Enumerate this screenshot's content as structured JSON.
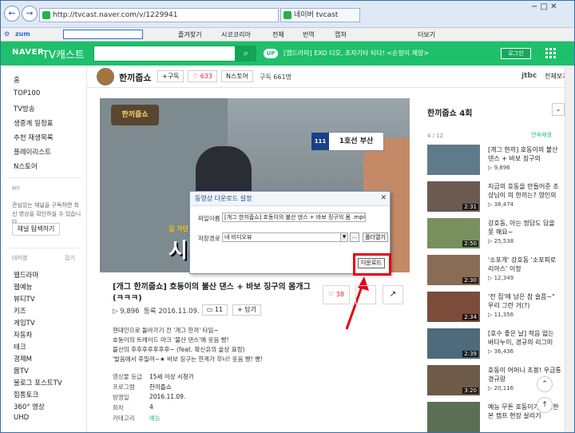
{
  "browser": {
    "back": "←",
    "forward": "→",
    "address": "http://tvcast.naver.com/v/1229941",
    "tab_label": "네이버 tvcast",
    "win_controls": "− □ ✕",
    "toolbar": {
      "zum": "zum",
      "favorites": "즐겨찾기",
      "sicorea": "시코코리아",
      "full": "전체",
      "translate": "번역",
      "capture": "캡쳐",
      "extra": "더보기"
    }
  },
  "naver": {
    "logo": "NAVER",
    "service": "TV캐스트",
    "up_badge": "UP",
    "ticker": "[엠드라마] EXO 디오, 초자기타 되다! <순정이 제양>",
    "login": "로그인"
  },
  "sidebar": {
    "items": [
      "홈",
      "TOP100",
      "TV방송",
      "생중계 일정표",
      "추천 재생목록",
      "플레이리스트",
      "N스토어"
    ],
    "my_label": "MY",
    "my_desc_1": "관심있는 채널을 구독하면 최",
    "my_desc_2": "신 영상을 확인하실 수 있습니다.",
    "channel_btn": "채널 탐색하기",
    "theme_label": "테마별",
    "theme_toggle": "접기",
    "themes": [
      "웹드라마",
      "웹예능",
      "뷰티TV",
      "키즈",
      "게임TV",
      "자동차",
      "테크",
      "경제M",
      "몸TV",
      "불로그 포스트TV",
      "힙통토크",
      "360° 영상",
      "UHD"
    ]
  },
  "channel": {
    "name": "한끼줍쇼",
    "subscribe": "+구독",
    "likes": "♡ 633",
    "store": "N스토어",
    "followers": "구독 661명",
    "network": "jtbc",
    "network_channel": "전체보기"
  },
  "player": {
    "logo": "한끼줍쇼",
    "caption_small": "길 가던",
    "caption": "시단",
    "station_sign": "1호선 부산",
    "station_num": "111"
  },
  "dialog": {
    "title": "동영상 다운로드 설정",
    "close": "✕",
    "file_label": "파일이름",
    "file_value": "[개그 한끼줍쇼] 호동이의 불산 댄스 + 바보 징구의 몸 .mp4",
    "path_label": "저장경로",
    "path_value": "내 비디오뷰",
    "dots": "...",
    "open_folder": "폴더열기",
    "download": "다운로드"
  },
  "video": {
    "title": "[개그 한끼줍쇼] 호동이의 불산 댄스 + 바보 징구의 몸개그(ㅋㅋㅋ)",
    "views": "▷ 9,896",
    "date": "등록 2016.11.09.",
    "comments": "11",
    "share": "+ 담기",
    "likes": "♡ 38",
    "desc": [
      "현대인으로 돌아가기 전 '개그 한끼' 타임~",
      "호동이의 트레이드 마크 '불산 댄스'에 웃음 빵!",
      "불산의 후후후후후후후~ (feat. 확신유의 술상 표정)",
      "'발음에서 후밀려~★ 바보 징구는 한계가 무너! 웃음 빵! 빵!"
    ],
    "info": [
      {
        "k": "영상물 등급",
        "v": "15세 이상 시청가"
      },
      {
        "k": "프로그램",
        "v": "한끼줍쇼"
      },
      {
        "k": "방영일",
        "v": "2016.11.09."
      },
      {
        "k": "회차",
        "v": "4"
      },
      {
        "k": "카테고리",
        "v": "예능"
      }
    ]
  },
  "playlist": {
    "title": "한끼줍쇼 4회",
    "count": "4 / 12",
    "auto": "연속재생",
    "items": [
      {
        "title": "[개그 한끼] 호동이의 불산 댄스 + 바보 징구의",
        "views": "▷ 9,896",
        "dur": ""
      },
      {
        "title": "지금의 호동을 만들어준 조상님이 의 한끼는? 영인의",
        "views": "▷ 38,474",
        "dur": "2:31"
      },
      {
        "title": "강호동, 아는 정답도 답을 못 해요~",
        "views": "▷ 25,538",
        "dur": "2:50"
      },
      {
        "title": "'소포개' 강호동 '소포피로리아스' 이정",
        "views": "▷ 12,349",
        "dur": "2:30"
      },
      {
        "title": "'전 집'에 남은 참 슬픔~\" 우리 그런 거(?)",
        "views": "▷ 11,356",
        "dur": "2:34"
      },
      {
        "title": "[호수 좋은 날] 적음 없는 바다누이, 경규의 리그미",
        "views": "▷ 36,436",
        "dur": "2:39"
      },
      {
        "title": "호동이 어머니 초봉! 우금통 경규랑",
        "views": "▷ 20,116",
        "dur": "3:20"
      },
      {
        "title": "예능 무튼 호동이가 계획한 본 캠프 현장 살리기",
        "views": "",
        "dur": ""
      }
    ]
  }
}
